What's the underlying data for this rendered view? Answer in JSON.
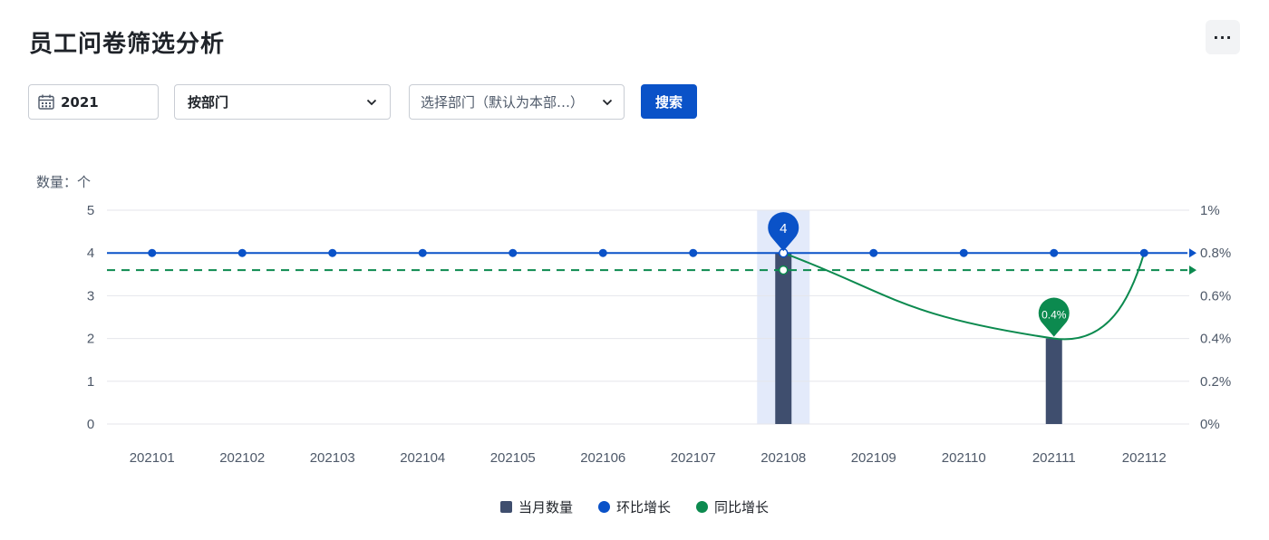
{
  "header": {
    "title": "员工问卷筛选分析",
    "more_label": "···"
  },
  "filters": {
    "year": "2021",
    "mode": "按部门",
    "dept_placeholder": "选择部门（默认为本部…）",
    "search_label": "搜索"
  },
  "chart_data": {
    "type": "bar",
    "y_unit_label": "数量：个",
    "categories": [
      "202101",
      "202102",
      "202103",
      "202104",
      "202105",
      "202106",
      "202107",
      "202108",
      "202109",
      "202110",
      "202111",
      "202112"
    ],
    "y_left": {
      "min": 0,
      "max": 5,
      "ticks": [
        0,
        1,
        2,
        3,
        4,
        5
      ]
    },
    "y_right": {
      "min": 0,
      "max": 1,
      "ticks": [
        "0%",
        "0.2%",
        "0.4%",
        "0.6%",
        "0.8%",
        "1%"
      ]
    },
    "series": [
      {
        "name": "当月数量",
        "type": "bar",
        "axis": "left",
        "values": [
          null,
          null,
          null,
          null,
          null,
          null,
          null,
          4,
          null,
          null,
          2,
          null
        ],
        "color": "#3f4e6e"
      },
      {
        "name": "环比增长",
        "type": "line",
        "axis": "left",
        "values": [
          4,
          4,
          4,
          4,
          4,
          4,
          4,
          4,
          4,
          4,
          4,
          4
        ],
        "color": "#0a52c8"
      },
      {
        "name": "同比增长",
        "type": "line",
        "axis": "right",
        "values": [
          null,
          null,
          null,
          null,
          null,
          null,
          null,
          0.8,
          null,
          null,
          0.4,
          0.8
        ],
        "color": "#0c8a4f"
      }
    ],
    "reference_line": {
      "axis": "right",
      "value": 0.72,
      "style": "dashed",
      "color": "#0c8a4f"
    },
    "highlight_category": "202108",
    "annotations": [
      {
        "category": "202108",
        "series": "当月数量",
        "label": "4",
        "color": "#0a52c8"
      },
      {
        "category": "202111",
        "series": "同比增长",
        "label": "0.4%",
        "color": "#0c8a4f"
      }
    ],
    "legend": [
      "当月数量",
      "环比增长",
      "同比增长"
    ],
    "legend_position": "bottom"
  }
}
